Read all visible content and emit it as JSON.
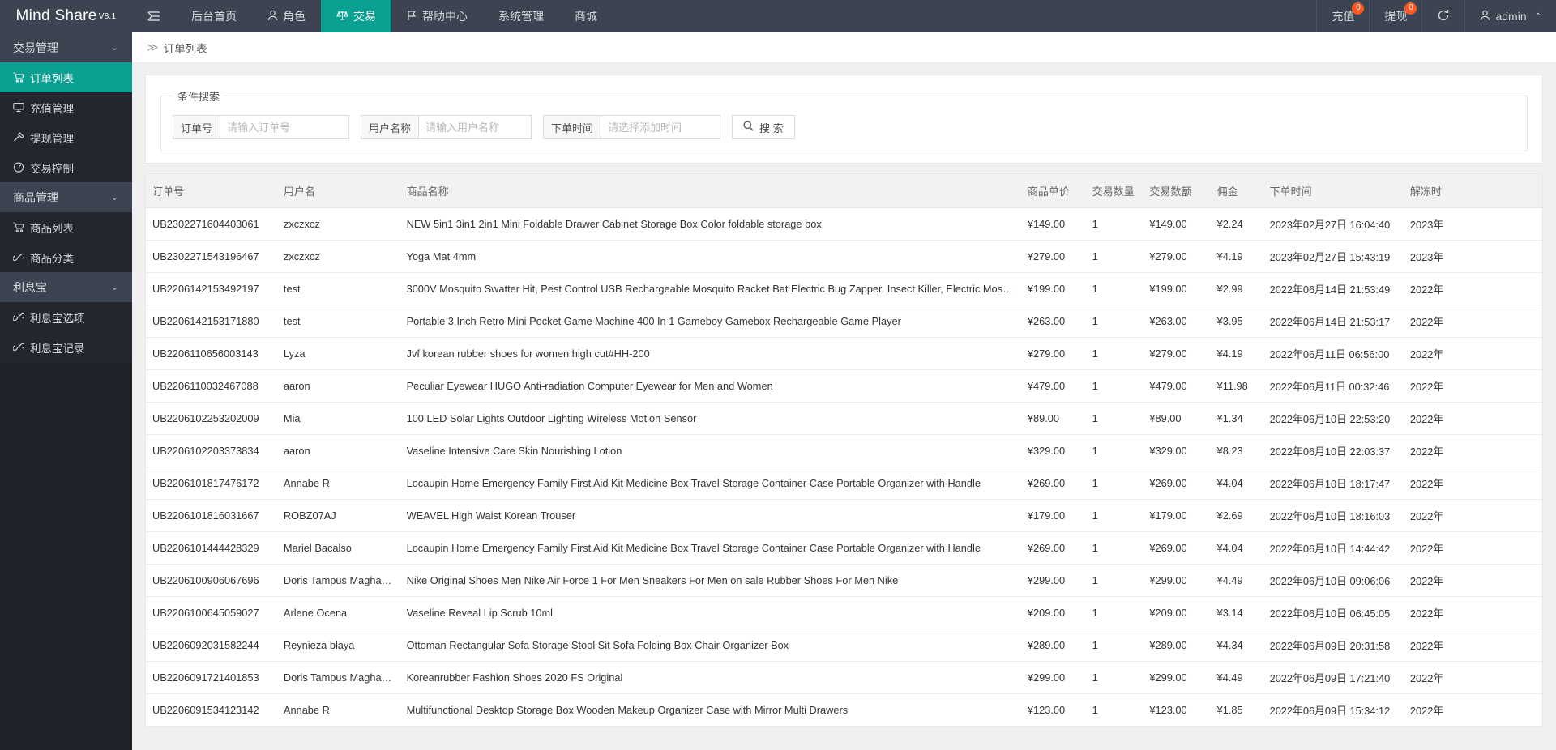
{
  "topbar": {
    "brand": "Mind Share",
    "brand_version": "V8.1",
    "menu_icon": "hamburger-icon",
    "nav": [
      {
        "label": "后台首页",
        "icon": "",
        "active": false
      },
      {
        "label": "角色",
        "icon": "user-icon",
        "active": false
      },
      {
        "label": "交易",
        "icon": "scale-icon",
        "active": true
      },
      {
        "label": "帮助中心",
        "icon": "flag-icon",
        "active": false
      },
      {
        "label": "系统管理",
        "icon": "",
        "active": false
      },
      {
        "label": "商城",
        "icon": "",
        "active": false
      }
    ],
    "right": {
      "recharge_label": "充值",
      "recharge_badge": "0",
      "withdraw_label": "提现",
      "withdraw_badge": "0",
      "refresh_icon": "refresh-icon",
      "user_name": "admin",
      "user_caret": "⌃"
    },
    "accent_color": "#0aa092",
    "bar_color": "#3c4452",
    "badge_color": "#ff5722"
  },
  "sidebar": {
    "groups": [
      {
        "label": "交易管理",
        "items": [
          {
            "label": "订单列表",
            "icon": "cart-icon",
            "active": true
          },
          {
            "label": "充值管理",
            "icon": "monitor-icon",
            "active": false
          },
          {
            "label": "提现管理",
            "icon": "hammer-icon",
            "active": false
          },
          {
            "label": "交易控制",
            "icon": "gauge-icon",
            "active": false
          }
        ]
      },
      {
        "label": "商品管理",
        "items": [
          {
            "label": "商品列表",
            "icon": "cart-icon",
            "active": false
          },
          {
            "label": "商品分类",
            "icon": "link-icon",
            "active": false
          }
        ]
      },
      {
        "label": "利息宝",
        "items": [
          {
            "label": "利息宝选项",
            "icon": "link-icon",
            "active": false
          },
          {
            "label": "利息宝记录",
            "icon": "link-icon",
            "active": false
          }
        ]
      }
    ]
  },
  "breadcrumb": {
    "separator": "≫",
    "current": "订单列表"
  },
  "search": {
    "legend": "条件搜索",
    "order_label": "订单号",
    "order_placeholder": "请输入订单号",
    "order_value": "",
    "user_label": "用户名称",
    "user_placeholder": "请输入用户名称",
    "user_value": "",
    "time_label": "下单时间",
    "time_placeholder": "请选择添加时间",
    "time_value": "",
    "search_button": "搜 索",
    "search_icon": "search-icon"
  },
  "table": {
    "columns": [
      "订单号",
      "用户名",
      "商品名称",
      "商品单价",
      "交易数量",
      "交易数额",
      "佣金",
      "下单时间",
      "解冻时"
    ],
    "rows": [
      [
        "UB2302271604403061",
        "zxczxcz",
        "NEW 5in1 3in1 2in1 Mini Foldable Drawer Cabinet Storage Box Color foldable storage box",
        "¥149.00",
        "1",
        "¥149.00",
        "¥2.24",
        "2023年02月27日 16:04:40",
        "2023年"
      ],
      [
        "UB2302271543196467",
        "zxczxcz",
        "Yoga Mat 4mm",
        "¥279.00",
        "1",
        "¥279.00",
        "¥4.19",
        "2023年02月27日 15:43:19",
        "2023年"
      ],
      [
        "UB2206142153492197",
        "test",
        "3000V Mosquito Swatter Hit, Pest Control USB Rechargeable Mosquito Racket Bat Electric Bug Zapper, Insect Killer, Electric Mosquito Killer",
        "¥199.00",
        "1",
        "¥199.00",
        "¥2.99",
        "2022年06月14日 21:53:49",
        "2022年"
      ],
      [
        "UB2206142153171880",
        "test",
        "Portable 3 Inch Retro Mini Pocket Game Machine 400 In 1 Gameboy Gamebox Rechargeable Game Player",
        "¥263.00",
        "1",
        "¥263.00",
        "¥3.95",
        "2022年06月14日 21:53:17",
        "2022年"
      ],
      [
        "UB2206110656003143",
        "Lyza",
        "Jvf korean rubber shoes for women high cut#HH-200",
        "¥279.00",
        "1",
        "¥279.00",
        "¥4.19",
        "2022年06月11日 06:56:00",
        "2022年"
      ],
      [
        "UB2206110032467088",
        "aaron",
        "Peculiar Eyewear HUGO Anti-radiation Computer Eyewear for Men and Women",
        "¥479.00",
        "1",
        "¥479.00",
        "¥11.98",
        "2022年06月11日 00:32:46",
        "2022年"
      ],
      [
        "UB2206102253202009",
        "Mia",
        "100 LED Solar Lights Outdoor Lighting Wireless Motion Sensor",
        "¥89.00",
        "1",
        "¥89.00",
        "¥1.34",
        "2022年06月10日 22:53:20",
        "2022年"
      ],
      [
        "UB2206102203373834",
        "aaron",
        "Vaseline Intensive Care Skin Nourishing Lotion",
        "¥329.00",
        "1",
        "¥329.00",
        "¥8.23",
        "2022年06月10日 22:03:37",
        "2022年"
      ],
      [
        "UB2206101817476172",
        "Annabe R",
        "Locaupin Home Emergency Family First Aid Kit Medicine Box Travel Storage Container Case Portable Organizer with Handle",
        "¥269.00",
        "1",
        "¥269.00",
        "¥4.04",
        "2022年06月10日 18:17:47",
        "2022年"
      ],
      [
        "UB2206101816031667",
        "ROBZ07AJ",
        "WEAVEL High Waist Korean Trouser",
        "¥179.00",
        "1",
        "¥179.00",
        "¥2.69",
        "2022年06月10日 18:16:03",
        "2022年"
      ],
      [
        "UB2206101444428329",
        "Mariel Bacalso",
        "Locaupin Home Emergency Family First Aid Kit Medicine Box Travel Storage Container Case Portable Organizer with Handle",
        "¥269.00",
        "1",
        "¥269.00",
        "¥4.04",
        "2022年06月10日 14:44:42",
        "2022年"
      ],
      [
        "UB2206100906067696",
        "Doris Tampus Maghanoy",
        "Nike Original Shoes Men Nike Air Force 1 For Men Sneakers For Men on sale Rubber Shoes For Men Nike",
        "¥299.00",
        "1",
        "¥299.00",
        "¥4.49",
        "2022年06月10日 09:06:06",
        "2022年"
      ],
      [
        "UB2206100645059027",
        "Arlene Ocena",
        "Vaseline Reveal Lip Scrub 10ml",
        "¥209.00",
        "1",
        "¥209.00",
        "¥3.14",
        "2022年06月10日 06:45:05",
        "2022年"
      ],
      [
        "UB2206092031582244",
        "Reynieza blaya",
        "Ottoman Rectangular Sofa Storage Stool Sit Sofa Folding Box Chair Organizer Box",
        "¥289.00",
        "1",
        "¥289.00",
        "¥4.34",
        "2022年06月09日 20:31:58",
        "2022年"
      ],
      [
        "UB2206091721401853",
        "Doris Tampus Maghanoy",
        "Koreanrubber Fashion Shoes 2020 FS Original",
        "¥299.00",
        "1",
        "¥299.00",
        "¥4.49",
        "2022年06月09日 17:21:40",
        "2022年"
      ],
      [
        "UB2206091534123142",
        "Annabe R",
        "Multifunctional Desktop Storage Box Wooden Makeup Organizer Case with Mirror Multi Drawers",
        "¥123.00",
        "1",
        "¥123.00",
        "¥1.85",
        "2022年06月09日 15:34:12",
        "2022年"
      ]
    ]
  }
}
